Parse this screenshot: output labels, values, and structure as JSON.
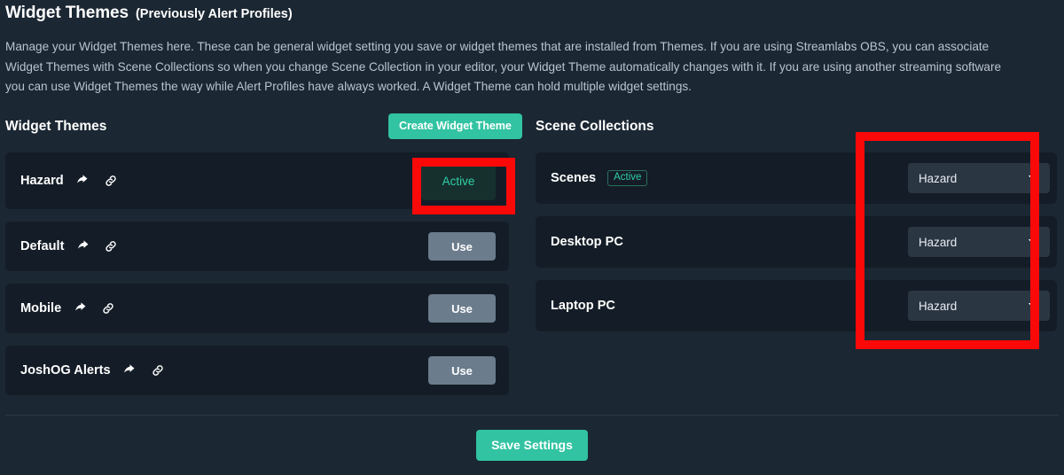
{
  "header": {
    "title": "Widget Themes",
    "subtitle": "(Previously Alert Profiles)",
    "description": "Manage your Widget Themes here. These can be general widget setting you save or widget themes that are installed from Themes. If you are using Streamlabs OBS, you can associate Widget Themes with Scene Collections so when you change Scene Collection in your editor, your Widget Theme automatically changes with it. If you are using another streaming software you can use Widget Themes the way while Alert Profiles have always worked. A Widget Theme can hold multiple widget settings."
  },
  "widget_themes": {
    "section_title": "Widget Themes",
    "create_button": "Create Widget Theme",
    "items": [
      {
        "name": "Hazard",
        "action_label": "Active",
        "state": "active",
        "share_icon": "share-icon",
        "link_icon": "link-icon"
      },
      {
        "name": "Default",
        "action_label": "Use",
        "state": "inactive",
        "share_icon": "share-icon",
        "link_icon": "link-icon"
      },
      {
        "name": "Mobile",
        "action_label": "Use",
        "state": "inactive",
        "share_icon": "share-icon",
        "link_icon": "link-icon"
      },
      {
        "name": "JoshOG Alerts",
        "action_label": "Use",
        "state": "inactive",
        "share_icon": "share-icon",
        "link_icon": "link-icon"
      }
    ]
  },
  "scene_collections": {
    "section_title": "Scene Collections",
    "items": [
      {
        "name": "Scenes",
        "badge": "Active",
        "selected_theme": "Hazard",
        "caret_icon": "chevron-down-icon"
      },
      {
        "name": "Desktop PC",
        "badge": null,
        "selected_theme": "Hazard",
        "caret_icon": "chevron-down-icon"
      },
      {
        "name": "Laptop PC",
        "badge": null,
        "selected_theme": "Hazard",
        "caret_icon": "chevron-down-icon"
      }
    ]
  },
  "footer": {
    "save_button": "Save Settings"
  },
  "colors": {
    "page_background": "#1b2733",
    "row_background": "#141d27",
    "accent_teal": "#31c3a2",
    "active_text": "#2fd0a6",
    "use_button": "#6b7c8d",
    "annotation_red": "#fb0909",
    "select_background": "#2b3643"
  },
  "annotations": [
    {
      "id": "active-button-highlight",
      "target": "Active button"
    },
    {
      "id": "theme-dropdowns-highlight",
      "target": "Scene collection theme dropdowns"
    }
  ]
}
